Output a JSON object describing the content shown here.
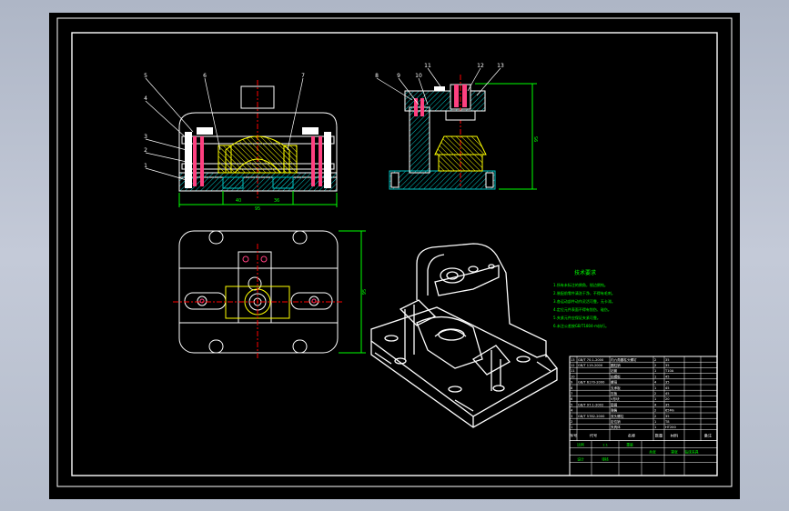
{
  "colors": {
    "background": "#b8bfce",
    "sheet": "#000000",
    "line": "#ffffff",
    "hatch": "#00c0c0",
    "part": "#ffff00",
    "dimension": "#00ff00",
    "center_line": "#ff0000",
    "bolt": "#ff4080",
    "notes_text": "#00ff00"
  },
  "front_view": {
    "callouts": [
      "5",
      "4",
      "3",
      "2",
      "1",
      "6",
      "7"
    ],
    "dimensions": [
      "95",
      "40",
      "36"
    ]
  },
  "side_view": {
    "callouts": [
      "8",
      "9",
      "10",
      "11",
      "12",
      "13"
    ],
    "dimensions": [
      "95"
    ]
  },
  "top_view": {
    "dimensions": [
      "95"
    ]
  },
  "tech_notes": {
    "title": "技术要求",
    "lines": [
      "1.所有未标注的倒角，锐边倒钝。",
      "2.装配前零件清洗干净，不得有毛刺。",
      "3.各运动部件动作灵活可靠，无卡滞。",
      "4.定位元件表面不得有划伤、碰伤。",
      "5.夹紧元件应保证夹紧可靠。",
      "6.未注公差按GB/T1804-m执行。"
    ]
  },
  "bom": {
    "header": [
      "序号",
      "代号",
      "名称",
      "数量",
      "材料",
      "备注"
    ],
    "rows": [
      [
        "13",
        "GB/T 70.1-2000",
        "内六角圆柱头螺钉",
        "2",
        "35",
        ""
      ],
      [
        "12",
        "GB/T 119-2000",
        "圆柱销",
        "2",
        "35",
        ""
      ],
      [
        "11",
        "",
        "钻套",
        "1",
        "T10A",
        ""
      ],
      [
        "10",
        "",
        "钻模板",
        "1",
        "45",
        ""
      ],
      [
        "9",
        "GB/T 6170-2000",
        "螺母",
        "4",
        "35",
        ""
      ],
      [
        "8",
        "",
        "支承板",
        "1",
        "45",
        ""
      ],
      [
        "7",
        "",
        "压板",
        "2",
        "45",
        ""
      ],
      [
        "6",
        "",
        "V形块",
        "1",
        "20",
        ""
      ],
      [
        "5",
        "GB/T 97.1-2002",
        "垫圈",
        "4",
        "35",
        ""
      ],
      [
        "4",
        "",
        "弹簧",
        "2",
        "65Mn",
        ""
      ],
      [
        "3",
        "GB/T 5782-2000",
        "双头螺柱",
        "2",
        "35",
        ""
      ],
      [
        "2",
        "",
        "定位销",
        "1",
        "T8",
        ""
      ],
      [
        "1",
        "",
        "夹具体",
        "1",
        "HT200",
        ""
      ]
    ],
    "title_block": [
      "比例",
      "1:1",
      "钻床夹具",
      "重量",
      "共张",
      "第张",
      "设计",
      "审核"
    ]
  }
}
